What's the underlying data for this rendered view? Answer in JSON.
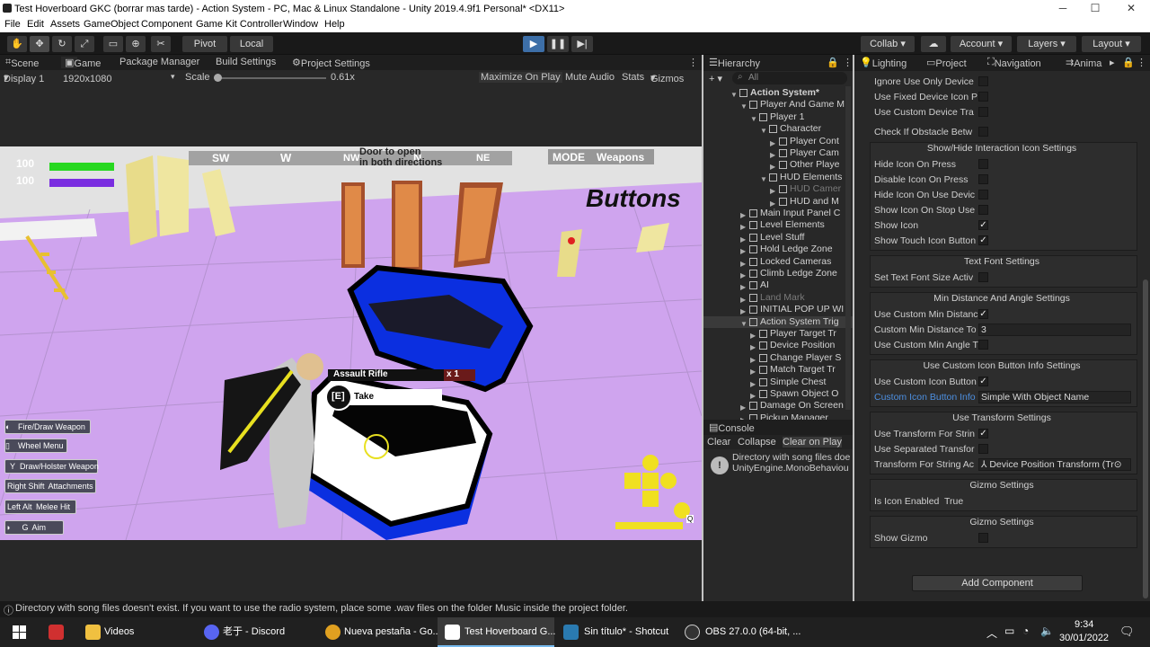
{
  "window": {
    "title": "Test Hoverboard GKC (borrar mas tarde) - Action System - PC, Mac & Linux Standalone - Unity 2019.4.9f1 Personal* <DX11>",
    "minimize": "─",
    "maximize": "☐",
    "close": "✕"
  },
  "menu": [
    "File",
    "Edit",
    "Assets",
    "GameObject",
    "Component",
    "Game Kit Controller",
    "Window",
    "Help"
  ],
  "toolbar": {
    "pivot": "Pivot",
    "local": "Local",
    "collab": "Collab",
    "account": "Account",
    "layers": "Layers",
    "layout": "Layout"
  },
  "left_tabs": {
    "scene": "Scene",
    "game": "Game",
    "package_manager": "Package Manager",
    "build_settings": "Build Settings",
    "project_settings": "Project Settings"
  },
  "game_bar": {
    "display": "Display 1",
    "resolution": "1920x1080",
    "scale_label": "Scale",
    "scale_value": "0.61x",
    "maximize": "Maximize On Play",
    "mute": "Mute Audio",
    "stats": "Stats",
    "gizmos": "Gizmos"
  },
  "hud": {
    "health": "100",
    "energy": "100",
    "compass": [
      "SW",
      "W",
      "NW",
      "N",
      "NE"
    ],
    "mode": "MODE",
    "weapons": "Weapons",
    "sign_buttons": "Buttons",
    "sign_door": "Door to open\nin both directions",
    "item_name": "Assault Rifle",
    "item_count": "x 1",
    "take_key": "[E]",
    "take_label": "Take",
    "controls": [
      {
        "key": "",
        "label": "Fire/Draw Weapon"
      },
      {
        "key": "",
        "label": "Wheel Menu"
      },
      {
        "key": "Y",
        "label": "Draw/Holster Weapon"
      },
      {
        "key": "Right Shift",
        "label": "Attachments"
      },
      {
        "key": "Left Alt",
        "label": "Melee Hit"
      },
      {
        "key": "G",
        "label": "Aim"
      }
    ],
    "pad_key": "Q"
  },
  "hierarchy": {
    "title": "Hierarchy",
    "search_placeholder": "All",
    "rows": [
      {
        "label": "Action System*",
        "indent": 0,
        "bold": true
      },
      {
        "label": "Player And Game M",
        "indent": 1
      },
      {
        "label": "Player 1",
        "indent": 2
      },
      {
        "label": "Character",
        "indent": 3
      },
      {
        "label": "Player Cont",
        "indent": 4
      },
      {
        "label": "Player Cam",
        "indent": 4
      },
      {
        "label": "Other Playe",
        "indent": 4
      },
      {
        "label": "HUD Elements",
        "indent": 3
      },
      {
        "label": "HUD Camer",
        "indent": 4,
        "dim": true
      },
      {
        "label": "HUD and M",
        "indent": 4
      },
      {
        "label": "Main Input Panel C",
        "indent": 1
      },
      {
        "label": "Level Elements",
        "indent": 1
      },
      {
        "label": "Level Stuff",
        "indent": 1
      },
      {
        "label": "Hold Ledge Zone",
        "indent": 1
      },
      {
        "label": "Locked Cameras",
        "indent": 1
      },
      {
        "label": "Climb Ledge Zone",
        "indent": 1
      },
      {
        "label": "AI",
        "indent": 1
      },
      {
        "label": "Land Mark",
        "indent": 1,
        "dim": true
      },
      {
        "label": "INITIAL POP UP WI",
        "indent": 1
      },
      {
        "label": "Action System Trig",
        "indent": 1,
        "sel": true
      },
      {
        "label": "Player Target Tr",
        "indent": 2
      },
      {
        "label": "Device Position",
        "indent": 2
      },
      {
        "label": "Change Player S",
        "indent": 2
      },
      {
        "label": "Match Target Tr",
        "indent": 2
      },
      {
        "label": "Simple Chest",
        "indent": 2
      },
      {
        "label": "Spawn Object O",
        "indent": 2
      },
      {
        "label": "Damage On Screen",
        "indent": 1
      },
      {
        "label": "Pickup Manager",
        "indent": 1
      }
    ]
  },
  "console": {
    "title": "Console",
    "clear": "Clear",
    "collapse": "Collapse",
    "clear_on_play": "Clear on Play",
    "message": "Directory with song files doe\nUnityEngine.MonoBehaviou"
  },
  "inspector_tabs": {
    "lighting": "Lighting",
    "project": "Project",
    "navigation": "Navigation",
    "animator": "Anima"
  },
  "inspector": {
    "top": [
      {
        "label": "Ignore Use Only Device",
        "type": "chk",
        "value": ""
      },
      {
        "label": "Use Fixed Device Icon P",
        "type": "chk",
        "value": ""
      },
      {
        "label": "Use Custom Device Tra",
        "type": "chk",
        "value": ""
      },
      {
        "label": "Check If Obstacle Betw",
        "type": "chk",
        "value": ""
      }
    ],
    "sections": [
      {
        "title": "Show/Hide Interaction Icon Settings",
        "rows": [
          {
            "label": "Hide Icon On Press",
            "type": "chk",
            "value": ""
          },
          {
            "label": "Disable Icon On Press",
            "type": "chk",
            "value": ""
          },
          {
            "label": "Hide Icon On Use Devic",
            "type": "chk",
            "value": ""
          },
          {
            "label": "Show Icon On Stop Use",
            "type": "chk",
            "value": ""
          },
          {
            "label": "Show Icon",
            "type": "chk",
            "value": "✓"
          },
          {
            "label": "Show Touch Icon Button",
            "type": "chk",
            "value": "✓"
          }
        ]
      },
      {
        "title": "Text Font Settings",
        "rows": [
          {
            "label": "Set Text Font Size Activ",
            "type": "chk",
            "value": ""
          }
        ]
      },
      {
        "title": "Min Distance And Angle Settings",
        "rows": [
          {
            "label": "Use Custom Min Distanc",
            "type": "chk",
            "value": "✓"
          },
          {
            "label": "Custom Min Distance To",
            "type": "fld",
            "value": "3"
          },
          {
            "label": "Use Custom Min Angle T",
            "type": "chk",
            "value": ""
          }
        ]
      },
      {
        "title": "Use Custom Icon Button Info Settings",
        "rows": [
          {
            "label": "Use Custom Icon Button",
            "type": "chk",
            "value": "✓"
          },
          {
            "label": "Custom Icon Button Info",
            "type": "fld",
            "value": "Simple With Object Name",
            "blue": true
          }
        ]
      },
      {
        "title": "Use Transform Settings",
        "rows": [
          {
            "label": "Use Transform For Strin",
            "type": "chk",
            "value": "✓"
          },
          {
            "label": "Use Separated Transfor",
            "type": "chk",
            "value": ""
          },
          {
            "label": "Transform For String Ac",
            "type": "fld",
            "value": "⅄ Device Position Transform (Tr⊙"
          }
        ]
      },
      {
        "title": "Gizmo Settings",
        "rows": [
          {
            "label": "Is Icon Enabled",
            "type": "txt",
            "value": "True"
          }
        ]
      },
      {
        "title": "Gizmo Settings",
        "rows": [
          {
            "label": "Show Gizmo",
            "type": "chk",
            "value": ""
          }
        ]
      }
    ],
    "add_component": "Add Component"
  },
  "status": "Directory with song files doesn't exist. If you want to use the radio system, place some .wav files on the folder Music inside the project folder.",
  "taskbar": {
    "items": [
      "Videos",
      "老于 - Discord",
      "Nueva pestaña - Go...",
      "Test Hoverboard G...",
      "Sin título* - Shotcut",
      "OBS 27.0.0 (64-bit, ..."
    ],
    "time": "9:34",
    "date": "30/01/2022"
  },
  "colors": {
    "bg": "#282828",
    "floor": "#cfa4ee",
    "hierarchy_selected": "#3a3a3a",
    "link": "#4d8fe0"
  }
}
